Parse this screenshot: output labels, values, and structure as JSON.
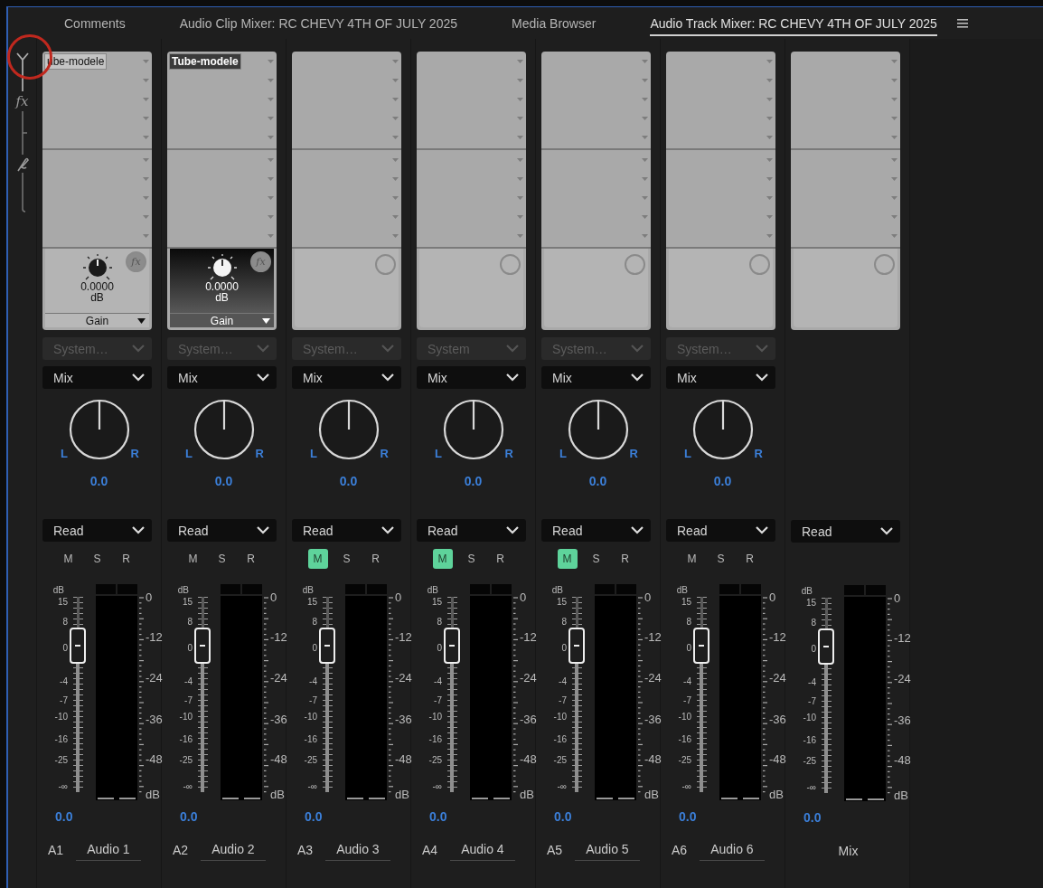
{
  "tabs": [
    {
      "label": "Comments",
      "selected": false
    },
    {
      "label": "Audio Clip Mixer: RC CHEVY 4TH OF JULY 2025",
      "selected": false
    },
    {
      "label": "Media Browser",
      "selected": false
    },
    {
      "label": "Audio Track Mixer: RC CHEVY 4TH OF JULY 2025",
      "selected": true
    }
  ],
  "rail": {
    "effects_label": "fx"
  },
  "tracks": [
    {
      "kind": "track",
      "id": "A1",
      "name": "Audio 1",
      "effects": [
        {
          "name": "ube-modele",
          "selected": false
        }
      ],
      "param": {
        "value": "0.0000",
        "unit": "dB",
        "name": "Gain",
        "bypass_label": "fx",
        "selected": false
      },
      "send": {
        "label": "System…",
        "disabled": true
      },
      "pan_mode": "Mix",
      "pan": {
        "left": "L",
        "right": "R",
        "value": "0.0"
      },
      "automation": "Read",
      "buttons": [
        {
          "label": "M",
          "on": false
        },
        {
          "label": "S",
          "on": false
        },
        {
          "label": "R",
          "on": false
        }
      ],
      "fader": {
        "level": 0.75,
        "scale": [
          "dB",
          "15",
          "8",
          "0",
          "-4",
          "-7",
          "-10",
          "-16",
          "-25",
          "-∞"
        ]
      },
      "meter_scale": [
        "0",
        "-12",
        "-24",
        "-36",
        "-48",
        "dB"
      ],
      "volume": "0.0"
    },
    {
      "kind": "track",
      "id": "A2",
      "name": "Audio 2",
      "effects": [
        {
          "name": "Tube-modele",
          "selected": true
        }
      ],
      "param": {
        "value": "0.0000",
        "unit": "dB",
        "name": "Gain",
        "bypass_label": "fx",
        "selected": true
      },
      "send": {
        "label": "System…",
        "disabled": true
      },
      "pan_mode": "Mix",
      "pan": {
        "left": "L",
        "right": "R",
        "value": "0.0"
      },
      "automation": "Read",
      "buttons": [
        {
          "label": "M",
          "on": false
        },
        {
          "label": "S",
          "on": false
        },
        {
          "label": "R",
          "on": false
        }
      ],
      "fader": {
        "level": 0.75,
        "scale": [
          "dB",
          "15",
          "8",
          "0",
          "-4",
          "-7",
          "-10",
          "-16",
          "-25",
          "-∞"
        ]
      },
      "meter_scale": [
        "0",
        "-12",
        "-24",
        "-36",
        "-48",
        "dB"
      ],
      "volume": "0.0"
    },
    {
      "kind": "track",
      "id": "A3",
      "name": "Audio 3",
      "send": {
        "label": "System…",
        "disabled": true
      },
      "pan_mode": "Mix",
      "pan": {
        "left": "L",
        "right": "R",
        "value": "0.0"
      },
      "automation": "Read",
      "buttons": [
        {
          "label": "M",
          "on": true
        },
        {
          "label": "S",
          "on": false
        },
        {
          "label": "R",
          "on": false
        }
      ],
      "fader": {
        "level": 0.75,
        "scale": [
          "dB",
          "15",
          "8",
          "0",
          "-4",
          "-7",
          "-10",
          "-16",
          "-25",
          "-∞"
        ]
      },
      "meter_scale": [
        "0",
        "-12",
        "-24",
        "-36",
        "-48",
        "dB"
      ],
      "volume": "0.0"
    },
    {
      "kind": "track",
      "id": "A4",
      "name": "Audio 4",
      "send": {
        "label": "System",
        "disabled": true
      },
      "pan_mode": "Mix",
      "pan": {
        "left": "L",
        "right": "R",
        "value": "0.0"
      },
      "automation": "Read",
      "buttons": [
        {
          "label": "M",
          "on": true
        },
        {
          "label": "S",
          "on": false
        },
        {
          "label": "R",
          "on": false
        }
      ],
      "fader": {
        "level": 0.75,
        "scale": [
          "dB",
          "15",
          "8",
          "0",
          "-4",
          "-7",
          "-10",
          "-16",
          "-25",
          "-∞"
        ]
      },
      "meter_scale": [
        "0",
        "-12",
        "-24",
        "-36",
        "-48",
        "dB"
      ],
      "volume": "0.0"
    },
    {
      "kind": "track",
      "id": "A5",
      "name": "Audio 5",
      "send": {
        "label": "System…",
        "disabled": true
      },
      "pan_mode": "Mix",
      "pan": {
        "left": "L",
        "right": "R",
        "value": "0.0"
      },
      "automation": "Read",
      "buttons": [
        {
          "label": "M",
          "on": true
        },
        {
          "label": "S",
          "on": false
        },
        {
          "label": "R",
          "on": false
        }
      ],
      "fader": {
        "level": 0.75,
        "scale": [
          "dB",
          "15",
          "8",
          "0",
          "-4",
          "-7",
          "-10",
          "-16",
          "-25",
          "-∞"
        ]
      },
      "meter_scale": [
        "0",
        "-12",
        "-24",
        "-36",
        "-48",
        "dB"
      ],
      "volume": "0.0"
    },
    {
      "kind": "track",
      "id": "A6",
      "name": "Audio 6",
      "send": {
        "label": "System…",
        "disabled": true
      },
      "pan_mode": "Mix",
      "pan": {
        "left": "L",
        "right": "R",
        "value": "0.0"
      },
      "automation": "Read",
      "buttons": [
        {
          "label": "M",
          "on": false
        },
        {
          "label": "S",
          "on": false
        },
        {
          "label": "R",
          "on": false
        }
      ],
      "fader": {
        "level": 0.75,
        "scale": [
          "dB",
          "15",
          "8",
          "0",
          "-4",
          "-7",
          "-10",
          "-16",
          "-25",
          "-∞"
        ]
      },
      "meter_scale": [
        "0",
        "-12",
        "-24",
        "-36",
        "-48",
        "dB"
      ],
      "volume": "0.0"
    },
    {
      "kind": "master",
      "name": "Mix",
      "automation": "Read",
      "fader": {
        "level": 0.75,
        "scale": [
          "dB",
          "15",
          "8",
          "0",
          "-4",
          "-7",
          "-10",
          "-16",
          "-25",
          "-∞"
        ]
      },
      "meter_scale": [
        "0",
        "-12",
        "-24",
        "-36",
        "-48",
        "dB"
      ],
      "volume": "0.0"
    }
  ],
  "overlays": {
    "highlight_ring": true
  }
}
